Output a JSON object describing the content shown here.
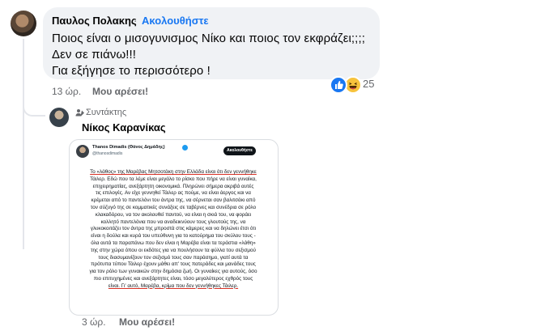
{
  "comment": {
    "author": "Παυλος Πολακης",
    "separator": "·",
    "follow_label": "Ακολουθήστε",
    "lines": [
      "Ποιος είναι ο μισογυνισμος Νίκο και ποιος τον εκφράζει;;;;",
      "Δεν σε πιάνω!!!",
      "Για εξήγησε το περισσότερο !"
    ],
    "reaction_count": "25",
    "reactions": [
      "like-icon",
      "haha-icon"
    ],
    "time": "13 ώρ.",
    "like_action": "Μου αρέσει!"
  },
  "reply": {
    "role": "Συντάκτης",
    "author": "Νίκος Καρανίκας",
    "time": "3 ώρ.",
    "like_action": "Μου αρέσει!",
    "tweet": {
      "name": "Thanos Dimadis (Θάνος Δημάδης)",
      "handle": "@thanosdimadis",
      "follow_label": "Ακολουθήστε",
      "lines": [
        "Το «λάθος» της Μαρέβας Μητσοτάκη στην Ελλάδα είναι ότι δεν γεννήθηκε",
        "Τάιλερ. Εδώ που τα λέμε είναι μεγάλο το ρίσκο που πήρε να είναι γυναίκα,",
        "επιχειρηματίας, ανεξάρτητη οικονομικά. Πληρώνει σήμερα ακριβά αυτές",
        "τις επιλογές. Αν είχε γεννηθεί Τάιλερ ας πούμε, να είναι άεργος και να",
        "κρέμεται από το παντελόνι του άντρα της, να σέρνεται σαν βαλιτσάκι από",
        "τον σύζυγό της σε κομματικές συνάξεις σε ταβέρνες και συνέδρια σε ρόλο",
        "κλακαδόρου, να τον ακολουθεί παντού, να είναι η σκιά του, να φοράει",
        "κολλητό παντελόνια που να αναδεικνύουν τους γλουτούς της, να",
        "γλυκοκοιτάζει τον άντρα της μπροστά στις κάμερες και να δηλώνει έτσι ότι",
        "είναι η δούλα και κυρά του υπεύθυνη για το κατούρημα του σκύλου τους -",
        "όλα αυτά τα παραπάνω που δεν είναι η Μαρέβα είναι τα τεράστια «λάθη»",
        "της στην χώρα όπου οι εκδότες για να πουλήσουν τα φύλλα του σεξισμού",
        "τους διασυμανίζουν τον σεξισμό τους σαν παράσημο, γιατί αυτά τα",
        "πρότυπα τύπου Τάιλερ έχουν μάθει απ' τους πατεράδες και μανάδες τους",
        "για τον ρόλο των γυναικών στην δημόσια ζωή. Οι γυναίκες για αυτούς, όσο",
        "πιο επιτυχημένες και ανεξάρτητες είναι, τόσο μεγαλύτερος εχθρός τους",
        "είναι. Γι' αυτό, Μαρέβα, κρίμα που δεν γεννήθηκες Τάιλερ."
      ]
    }
  },
  "colors": {
    "accent": "#1877f2",
    "bubble": "#f0f2f5",
    "meta": "#65676b",
    "underline": "#d93025"
  }
}
